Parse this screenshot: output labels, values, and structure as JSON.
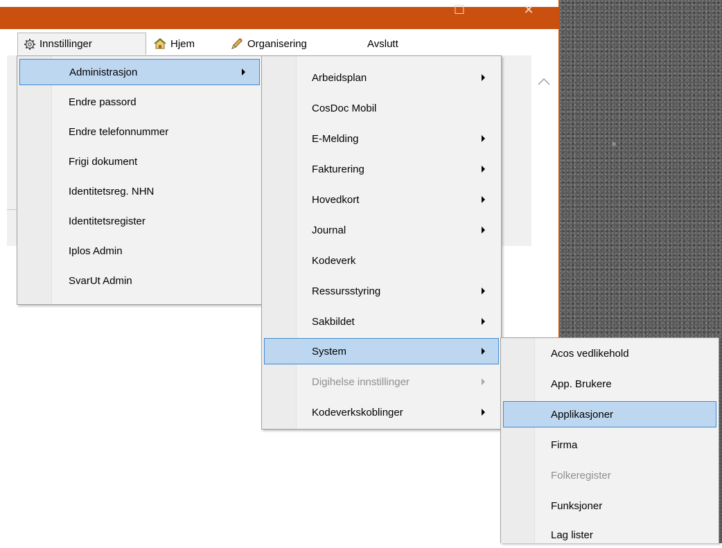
{
  "window": {
    "maximize_glyph": "☐",
    "close_glyph": "✕",
    "accent": "#ca5010"
  },
  "menubar": {
    "items": [
      {
        "label": "Innstillinger",
        "icon": "gear-icon"
      },
      {
        "label": "Hjem",
        "icon": "home-icon"
      },
      {
        "label": "Organisering",
        "icon": "pencil-icon"
      },
      {
        "label": "Avslutt"
      }
    ]
  },
  "menus": {
    "innstillinger": {
      "items": [
        {
          "label": "Administrasjon",
          "submenu": true,
          "highlighted": true
        },
        {
          "label": "Endre passord"
        },
        {
          "label": "Endre telefonnummer"
        },
        {
          "label": "Frigi dokument"
        },
        {
          "label": "Identitetsreg. NHN"
        },
        {
          "label": "Identitetsregister"
        },
        {
          "label": "Iplos Admin"
        },
        {
          "label": "SvarUt Admin"
        }
      ]
    },
    "administrasjon": {
      "items": [
        {
          "label": "Arbeidsplan",
          "submenu": true
        },
        {
          "label": "CosDoc Mobil"
        },
        {
          "label": "E-Melding",
          "submenu": true
        },
        {
          "label": "Fakturering",
          "submenu": true
        },
        {
          "label": "Hovedkort",
          "submenu": true
        },
        {
          "label": "Journal",
          "submenu": true
        },
        {
          "label": "Kodeverk"
        },
        {
          "label": "Ressursstyring",
          "submenu": true
        },
        {
          "label": "Sakbildet",
          "submenu": true
        },
        {
          "label": "System",
          "submenu": true,
          "highlighted": true
        },
        {
          "label": "Digihelse innstillinger",
          "submenu": true,
          "disabled": true
        },
        {
          "label": "Kodeverkskoblinger",
          "submenu": true
        }
      ]
    },
    "system": {
      "items": [
        {
          "label": "Acos vedlikehold"
        },
        {
          "label": "App. Brukere"
        },
        {
          "label": "Applikasjoner",
          "highlighted": true
        },
        {
          "label": "Firma"
        },
        {
          "label": "Folkeregister",
          "disabled": true
        },
        {
          "label": "Funksjoner"
        },
        {
          "label": "Lag lister"
        }
      ]
    }
  },
  "colors": {
    "highlight_fill": "#bed7f0",
    "highlight_border": "#3e8ad1",
    "menu_bg": "#f2f2f2",
    "disabled_text": "#8f8f8f"
  }
}
